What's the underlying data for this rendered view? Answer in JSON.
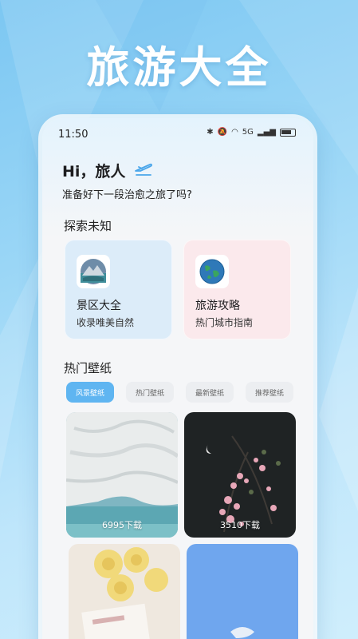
{
  "banner": {
    "title": "旅游大全"
  },
  "status_bar": {
    "time": "11:50",
    "network": "5G"
  },
  "greeting": {
    "title": "Hi，旅人",
    "subtitle": "准备好下一段治愈之旅了吗?"
  },
  "explore": {
    "section_title": "探索未知",
    "cards": [
      {
        "title": "景区大全",
        "desc": "收录唯美自然",
        "bg": "#dcecf9"
      },
      {
        "title": "旅游攻略",
        "desc": "热门城市指南",
        "bg": "#fbe9ec"
      }
    ]
  },
  "wallpapers": {
    "section_title": "热门壁纸",
    "tabs": [
      "风景壁纸",
      "热门壁纸",
      "最新壁纸",
      "推荐壁纸"
    ],
    "active_tab": 0,
    "items": [
      {
        "downloads": "6995下载"
      },
      {
        "downloads": "3510下载"
      },
      {
        "downloads": ""
      },
      {
        "downloads": ""
      }
    ]
  },
  "colors": {
    "accent": "#5fb5f1",
    "background": "#7cc7f2"
  }
}
